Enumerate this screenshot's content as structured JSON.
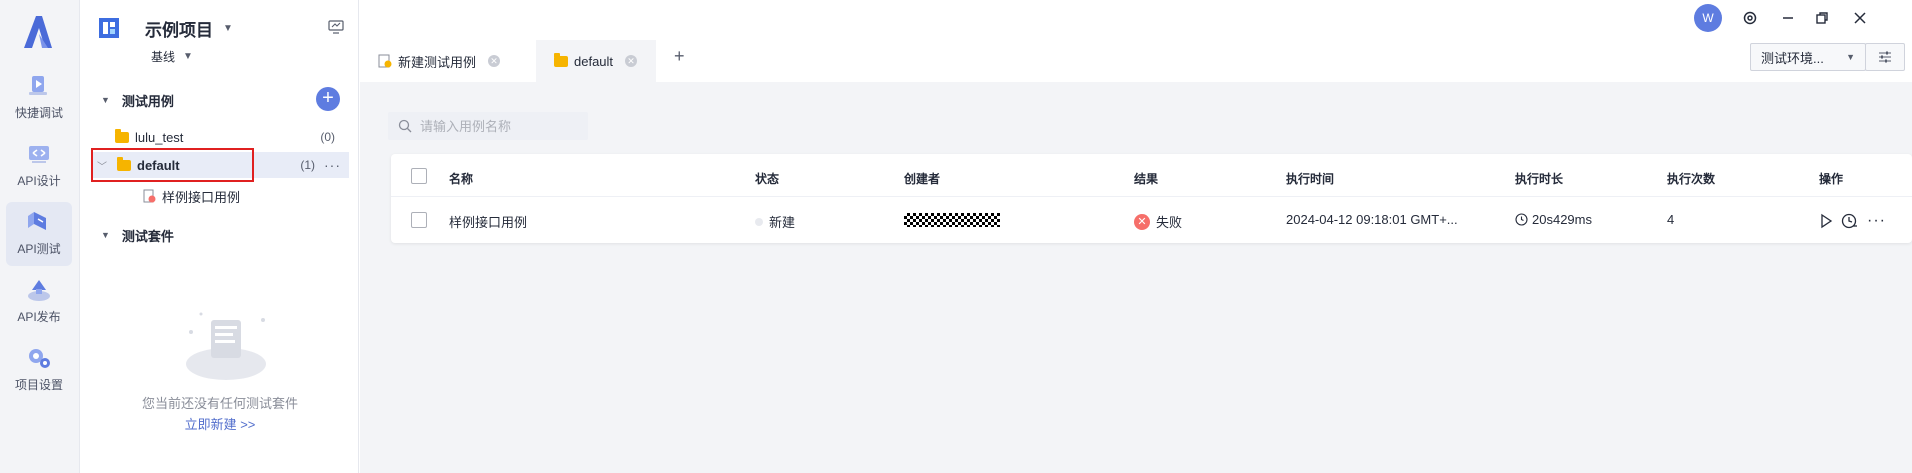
{
  "rail": {
    "items": [
      {
        "label": "快捷调试"
      },
      {
        "label": "API设计"
      },
      {
        "label": "API测试"
      },
      {
        "label": "API发布"
      },
      {
        "label": "项目设置"
      }
    ]
  },
  "project": {
    "title": "示例项目",
    "branch": "基线"
  },
  "tree": {
    "cases_heading": "测试用例",
    "folders": [
      {
        "name": "lulu_test",
        "count": "(0)"
      },
      {
        "name": "default",
        "count": "(1)"
      }
    ],
    "case_item": "样例接口用例",
    "suites_heading": "测试套件",
    "empty_text": "您当前还没有任何测试套件",
    "empty_link": "立即新建 >>"
  },
  "tabs": [
    {
      "label": "新建测试用例"
    },
    {
      "label": "default"
    }
  ],
  "user": {
    "avatar_initial": "W"
  },
  "env": {
    "select_label": "测试环境..."
  },
  "search": {
    "placeholder": "请输入用例名称"
  },
  "table": {
    "columns": [
      "名称",
      "状态",
      "创建者",
      "结果",
      "执行时间",
      "执行时长",
      "执行次数",
      "操作"
    ],
    "rows": [
      {
        "name": "样例接口用例",
        "status": "新建",
        "result": "失败",
        "exec_time": "2024-04-12 09:18:01 GMT+...",
        "duration": "20s429ms",
        "count": "4"
      }
    ]
  },
  "colors": {
    "accent": "#5e7ce0",
    "folder": "#f6b400",
    "fail": "#f66f6a",
    "highlight_box": "#e02020"
  }
}
